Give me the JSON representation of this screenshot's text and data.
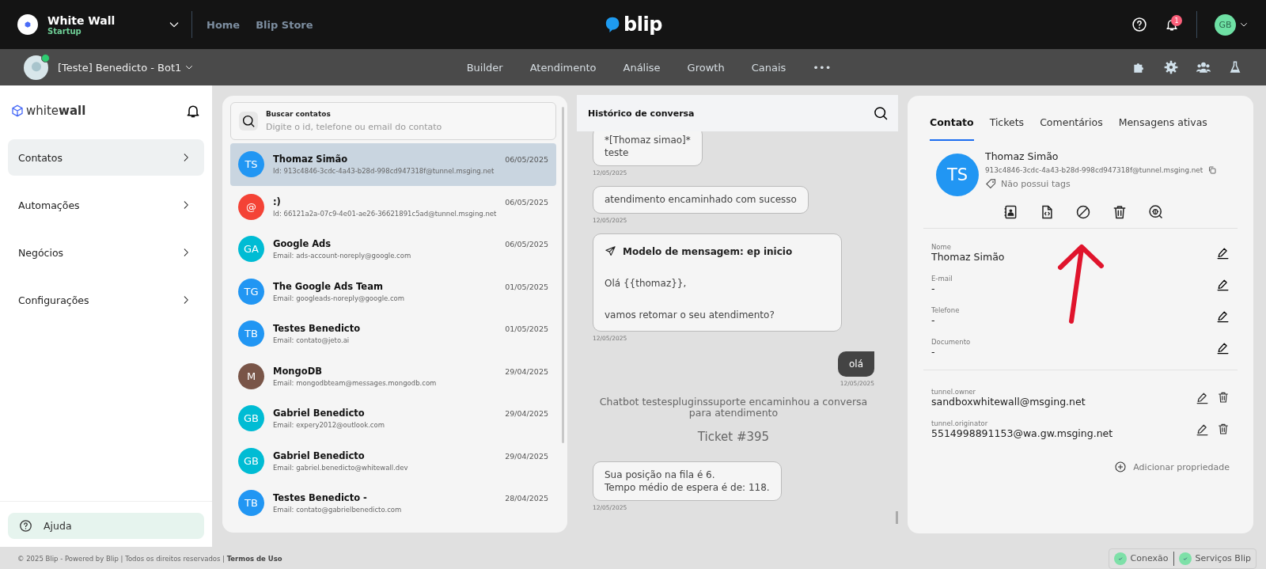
{
  "topbar": {
    "org_name": "White Wall",
    "org_plan": "Startup",
    "nav": [
      {
        "label": "Home"
      },
      {
        "label": "Blip Store"
      }
    ],
    "logo_text": "blip",
    "notification_count": "1",
    "user_initials": "GB"
  },
  "botbar": {
    "bot_name": "[Teste] Benedicto - Bot1",
    "online": true,
    "nav": [
      "Builder",
      "Atendimento",
      "Análise",
      "Growth",
      "Canais"
    ],
    "more": "•••"
  },
  "sidebar": {
    "brand_light": "white",
    "brand_bold": "wall",
    "items": [
      {
        "label": "Contatos",
        "selected": true
      },
      {
        "label": "Automações",
        "selected": false
      },
      {
        "label": "Negócios",
        "selected": false
      },
      {
        "label": "Configurações",
        "selected": false
      }
    ],
    "help": "Ajuda"
  },
  "contacts": {
    "search_label": "Buscar contatos",
    "search_placeholder": "Digite o id, telefone ou email do contato",
    "items": [
      {
        "initials": "TS",
        "name": "Thomaz Simão",
        "detail": "Id: 913c4846-3cdc-4a43-b28d-998cd947318f@tunnel.msging.net",
        "date": "06/05/2025",
        "color": "#2196f3",
        "selected": true
      },
      {
        "initials": "@",
        "name": ":)",
        "detail": "Id: 66121a2a-07c9-4e01-ae26-36621891c5ad@tunnel.msging.net",
        "date": "06/05/2025",
        "color": "#f44336",
        "selected": false
      },
      {
        "initials": "GA",
        "name": "Google Ads",
        "detail": "Email: ads-account-noreply@google.com",
        "date": "06/05/2025",
        "color": "#00bcd4",
        "selected": false
      },
      {
        "initials": "TG",
        "name": "The Google Ads Team",
        "detail": "Email: googleads-noreply@google.com",
        "date": "01/05/2025",
        "color": "#2196f3",
        "selected": false
      },
      {
        "initials": "TB",
        "name": "Testes Benedicto",
        "detail": "Email: contato@jeto.ai",
        "date": "01/05/2025",
        "color": "#2196f3",
        "selected": false
      },
      {
        "initials": "M",
        "name": "MongoDB",
        "detail": "Email: mongodbteam@messages.mongodb.com",
        "date": "29/04/2025",
        "color": "#795548",
        "selected": false
      },
      {
        "initials": "GB",
        "name": "Gabriel Benedicto",
        "detail": "Email: expery2012@outlook.com",
        "date": "29/04/2025",
        "color": "#00bcd4",
        "selected": false
      },
      {
        "initials": "GB",
        "name": "Gabriel Benedicto",
        "detail": "Email: gabriel.benedicto@whitewall.dev",
        "date": "29/04/2025",
        "color": "#00bcd4",
        "selected": false
      },
      {
        "initials": "TB",
        "name": "Testes Benedicto -",
        "detail": "Email: contato@gabrielbenedicto.com",
        "date": "28/04/2025",
        "color": "#2196f3",
        "selected": false
      }
    ]
  },
  "chat": {
    "title": "Histórico de conversa",
    "messages": [
      {
        "kind": "bubble",
        "lines": [
          "*[Thomaz simao]*",
          "teste"
        ],
        "time": "12/05/2025"
      },
      {
        "kind": "bubble",
        "lines": [
          "atendimento encaminhado com sucesso"
        ],
        "time": "12/05/2025"
      },
      {
        "kind": "template",
        "title": "Modelo de mensagem: ep inicio",
        "lines": [
          "Olá {{thomaz}},",
          "vamos retomar o seu atendimento?"
        ],
        "time": "12/05/2025"
      },
      {
        "kind": "sent",
        "lines": [
          "olá"
        ],
        "time": "12/05/2025"
      },
      {
        "kind": "system",
        "text": "Chatbot testespluginssuporte encaminhou a conversa para atendimento",
        "ticket": "Ticket #395"
      },
      {
        "kind": "bubble",
        "lines": [
          "Sua posição na fila é 6.",
          "Tempo médio de espera é de: 118."
        ],
        "time": "12/05/2025"
      }
    ]
  },
  "details": {
    "tabs": [
      {
        "label": "Contato",
        "selected": true
      },
      {
        "label": "Tickets",
        "selected": false
      },
      {
        "label": "Comentários",
        "selected": false
      },
      {
        "label": "Mensagens ativas",
        "selected": false
      }
    ],
    "initials": "TS",
    "name": "Thomaz Simão",
    "id": "913c4846-3cdc-4a43-b28d-998cd947318f@tunnel.msging.net",
    "tags": "Não possui tags",
    "fields": [
      {
        "label": "Nome",
        "value": "Thomaz Simão"
      },
      {
        "label": "E-mail",
        "value": "-"
      },
      {
        "label": "Telefone",
        "value": "-"
      },
      {
        "label": "Documento",
        "value": "-"
      }
    ],
    "extras": [
      {
        "label": "tunnel.owner",
        "value": "sandboxwhitewall@msging.net"
      },
      {
        "label": "tunnel.originator",
        "value": "5514998891153@wa.gw.msging.net"
      }
    ],
    "add": "Adicionar propriedade"
  },
  "footer": {
    "copyright": "© 2025 Blip - Powered by Blip | Todos os direitos reservados |",
    "terms": "Termos de Uso",
    "status": [
      {
        "label": "Conexão",
        "ok": true
      },
      {
        "label": "Serviços Blip",
        "ok": true
      }
    ]
  }
}
